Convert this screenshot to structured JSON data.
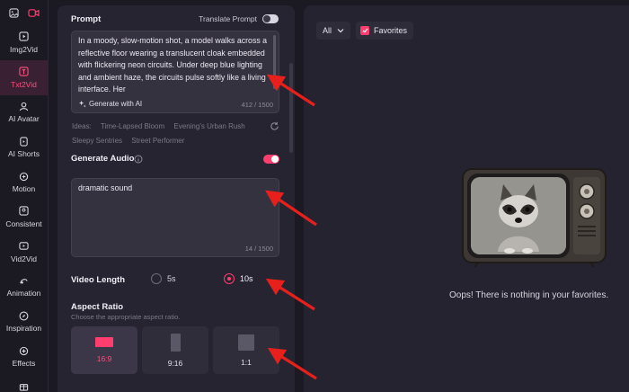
{
  "sidebar": {
    "top_icons": [
      "image-icon",
      "video-camera-icon"
    ],
    "items": [
      {
        "label": "Img2Vid",
        "icon": "image-video-icon",
        "active": false
      },
      {
        "label": "Txt2Vid",
        "icon": "text-video-icon",
        "active": true
      },
      {
        "label": "AI Avatar",
        "icon": "avatar-icon",
        "active": false
      },
      {
        "label": "AI Shorts",
        "icon": "shorts-icon",
        "active": false
      },
      {
        "label": "Motion",
        "icon": "motion-icon",
        "active": false
      },
      {
        "label": "Consistent",
        "icon": "consistent-icon",
        "active": false
      },
      {
        "label": "Vid2Vid",
        "icon": "vid2vid-icon",
        "active": false
      },
      {
        "label": "Animation",
        "icon": "animation-icon",
        "active": false
      },
      {
        "label": "Inspiration",
        "icon": "compass-icon",
        "active": false
      },
      {
        "label": "Effects",
        "icon": "effects-icon",
        "active": false
      }
    ]
  },
  "prompt": {
    "title": "Prompt",
    "translate_label": "Translate Prompt",
    "translate_on": false,
    "text": "In a moody, slow-motion shot, a model walks across a reflective floor wearing a translucent cloak embedded with flickering neon circuits. Under deep blue lighting and ambient haze, the circuits pulse softly like a living interface. Her",
    "generate_label": "Generate with AI",
    "counter": "412 / 1500",
    "ideas_label": "Ideas:",
    "ideas": [
      "Time-Lapsed Bloom",
      "Evening's Urban Rush",
      "Sleepy Sentries",
      "Street Performer"
    ]
  },
  "audio": {
    "title": "Generate Audio",
    "enabled": true,
    "text": "dramatic sound",
    "counter": "14 / 1500"
  },
  "video_length": {
    "title": "Video Length",
    "options": [
      "5s",
      "10s"
    ],
    "selected": "10s"
  },
  "aspect_ratio": {
    "title": "Aspect Ratio",
    "subtitle": "Choose the appropriate aspect ratio.",
    "options": [
      "16:9",
      "9:16",
      "1:1"
    ],
    "selected": "16:9"
  },
  "gallery": {
    "filter_value": "All",
    "favorites_label": "Favorites",
    "favorites_checked": true,
    "empty_message": "Oops! There is nothing in your favorites."
  },
  "colors": {
    "accent": "#ff3d6e",
    "bg": "#1b1a22",
    "panel": "#262430",
    "arrow": "#e8201c"
  }
}
